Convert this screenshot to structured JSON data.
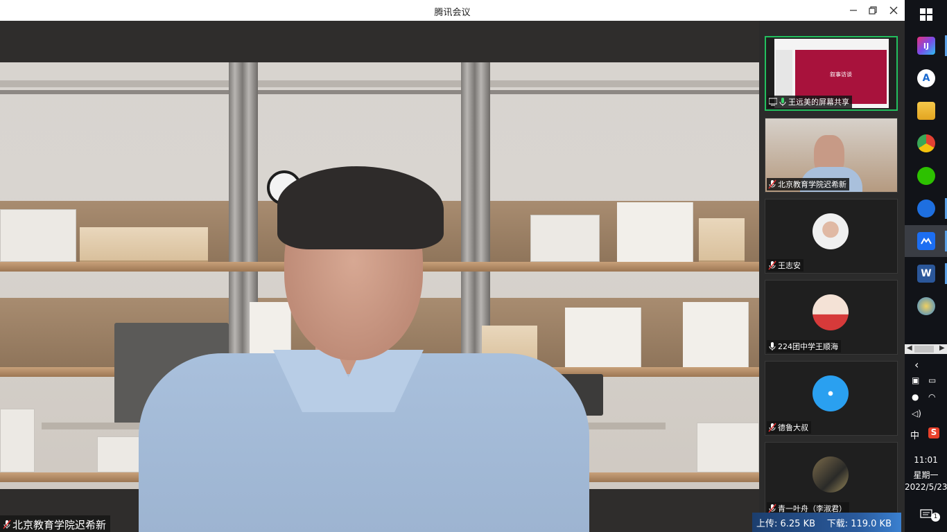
{
  "window": {
    "title": "腾讯会议"
  },
  "main": {
    "speaker_name": "北京教育学院迟希新"
  },
  "participants": [
    {
      "name": "王远美的屏幕共享",
      "type": "screen-share",
      "slide_title": "叙事访谈"
    },
    {
      "name": "北京教育学院迟希新",
      "type": "video"
    },
    {
      "name": "王志安",
      "type": "avatar"
    },
    {
      "name": "224团中学王顺海",
      "type": "avatar"
    },
    {
      "name": "德鲁大叔",
      "type": "avatar"
    },
    {
      "name": "青一叶舟（李淑君）",
      "type": "avatar"
    }
  ],
  "network": {
    "upload": "上传: 6.25 KB",
    "download": "下载: 119.0 KB"
  },
  "taskbar": {
    "ime": "中",
    "time": "11:01",
    "weekday": "星期一",
    "date": "2022/5/23",
    "notifications": "1"
  },
  "colors": {
    "active_border": "#22c05e",
    "slide_bg": "#a8123c",
    "net_bar": "#2a5a9c"
  }
}
